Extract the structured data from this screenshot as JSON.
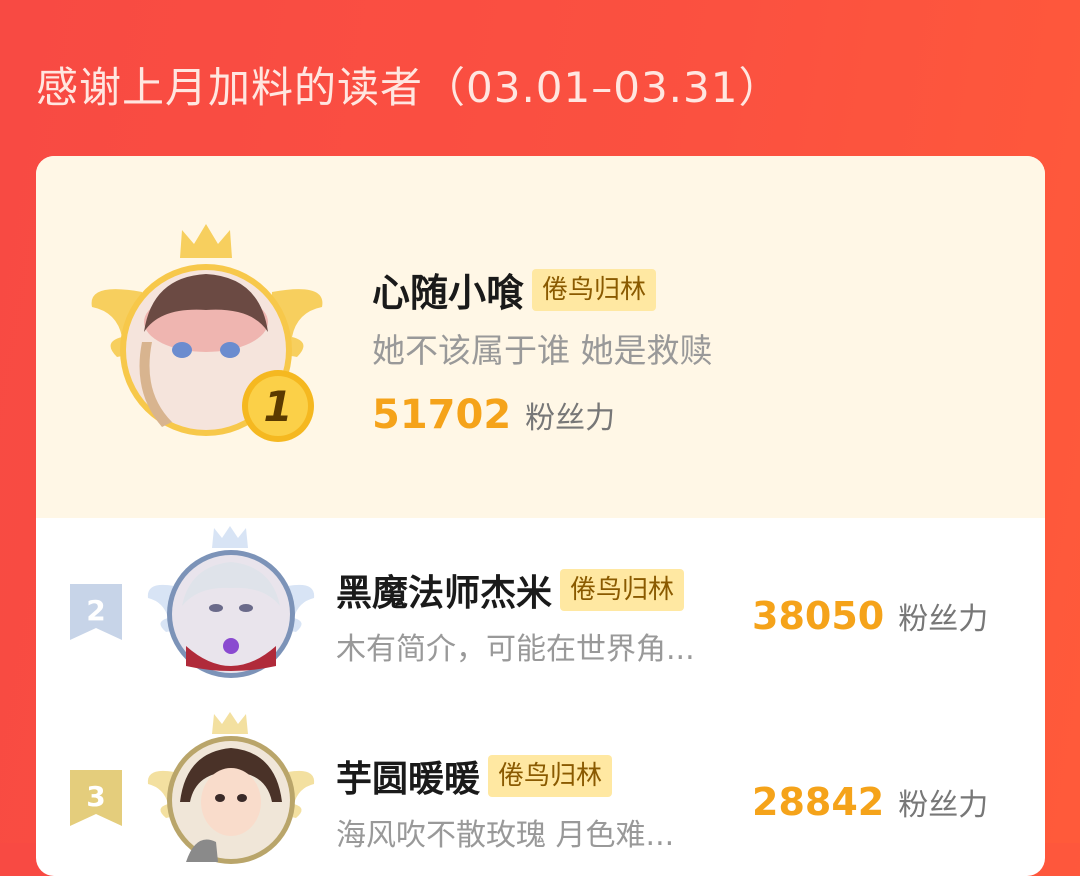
{
  "header": {
    "title": "感谢上月加料的读者（03.01–03.31）"
  },
  "winner": {
    "rank": "1",
    "name": "心随小喰",
    "badge": "倦鸟归林",
    "bio": "她不该属于谁 她是救赎",
    "points": "51702",
    "points_unit": "粉丝力"
  },
  "ranking": [
    {
      "rank": "2",
      "name": "黑魔法师杰米",
      "badge": "倦鸟归林",
      "bio": "木有简介，可能在世界角...",
      "points": "38050",
      "points_unit": "粉丝力"
    },
    {
      "rank": "3",
      "name": "芋圆暖暖",
      "badge": "倦鸟归林",
      "bio": "海风吹不散玫瑰 月色难...",
      "points": "28842",
      "points_unit": "粉丝力"
    }
  ],
  "colors": {
    "background": "#f84a43",
    "top_section": "#fff7e6",
    "gold": "#f5a31a",
    "badge_bg": "#ffe8a2",
    "badge_text": "#8a5a00"
  },
  "icons": {
    "crown": "crown-icon",
    "wings": "wings-icon",
    "rank_medal": "medal-icon"
  }
}
